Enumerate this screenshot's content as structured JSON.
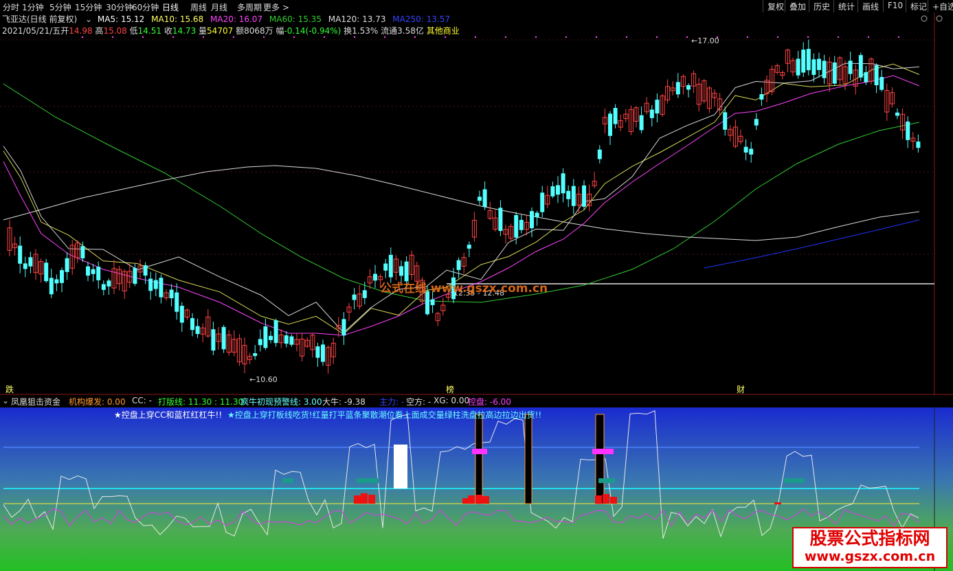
{
  "toolbar": {
    "periods": [
      "分时",
      "1分钟",
      "5分钟",
      "15分钟",
      "30分钟",
      "60分钟",
      "日线",
      "周线",
      "月线",
      "多周期",
      "更多 >"
    ],
    "active_period": "日线",
    "right_buttons": [
      "复权",
      "叠加",
      "历史",
      "统计",
      "画线",
      "F10",
      "标记",
      "+自选"
    ]
  },
  "stock": {
    "title": "飞亚达(日线 前复权)",
    "ma5": "MA5: 15.12",
    "ma10": "MA10: 15.68",
    "ma20": "MA20: 16.07",
    "ma60": "MA60: 15.35",
    "ma120": "MA120: 13.73",
    "ma250": "MA250: 13.57",
    "date": "2021/05/21/五",
    "open_label": "开",
    "open": "14.98",
    "high_label": "高",
    "high": "15.08",
    "low_label": "低",
    "low": "14.51",
    "close_label": "收",
    "close": "14.73",
    "volume_label": "量",
    "volume": "54707",
    "amount_label": "额",
    "amount": "8068万",
    "change_label": "幅",
    "change": "-0.14(-0.94%)",
    "turnover_label": "换",
    "turnover": "1.53%",
    "float_label": "流通",
    "float": "3.58亿",
    "sector": "其他商业"
  },
  "chart_annotations": {
    "high_mark": "17.00",
    "low_mark": "10.60",
    "range_label": "12.35 - 12.48",
    "watermark": "公式在线 www.gszx.com.cn"
  },
  "event_markers": {
    "m1": "跌",
    "m2": "榜",
    "m3": "财"
  },
  "indicator_panel": {
    "name": "凤凰狙击资金",
    "items": {
      "jigou": "机构爆发: 0.00",
      "cc": "CC: -",
      "daban": "打版线: 11.30 : 11.30",
      "fengniu": "疯牛初现预警线: 3.00",
      "daniu": "大牛: -9.38",
      "zhuli": "主力: -",
      "kongfang": "空方: -",
      "xg": "XG: 0.00",
      "kongpan": "控盘: -6.00"
    },
    "notes": {
      "note1": "★控盘上穿CC和蓝杠红杠牛!!",
      "note2": "★控盘上穿打板线吃货!红量打平蓝条聚散潮位看上面成交量绿柱洗盘拉高边拉边出货!!"
    }
  },
  "logo": {
    "line1": "股票公式指标网",
    "line2": "www.gszx.com.cn"
  },
  "colors": {
    "up": "#ff4444",
    "down": "#54ffff",
    "ma5": "#ffffff",
    "ma10": "#ffff66",
    "ma20": "#ff44ff",
    "ma60": "#33cc33",
    "ma120": "#dddddd",
    "ma250": "#2233ff"
  },
  "chart_data": {
    "type": "candlestick",
    "price_axis_approx": [
      10.0,
      17.5
    ],
    "recent_high": 17.0,
    "recent_low": 10.6,
    "last_bar": {
      "open": 14.98,
      "high": 15.08,
      "low": 14.51,
      "close": 14.73
    }
  }
}
